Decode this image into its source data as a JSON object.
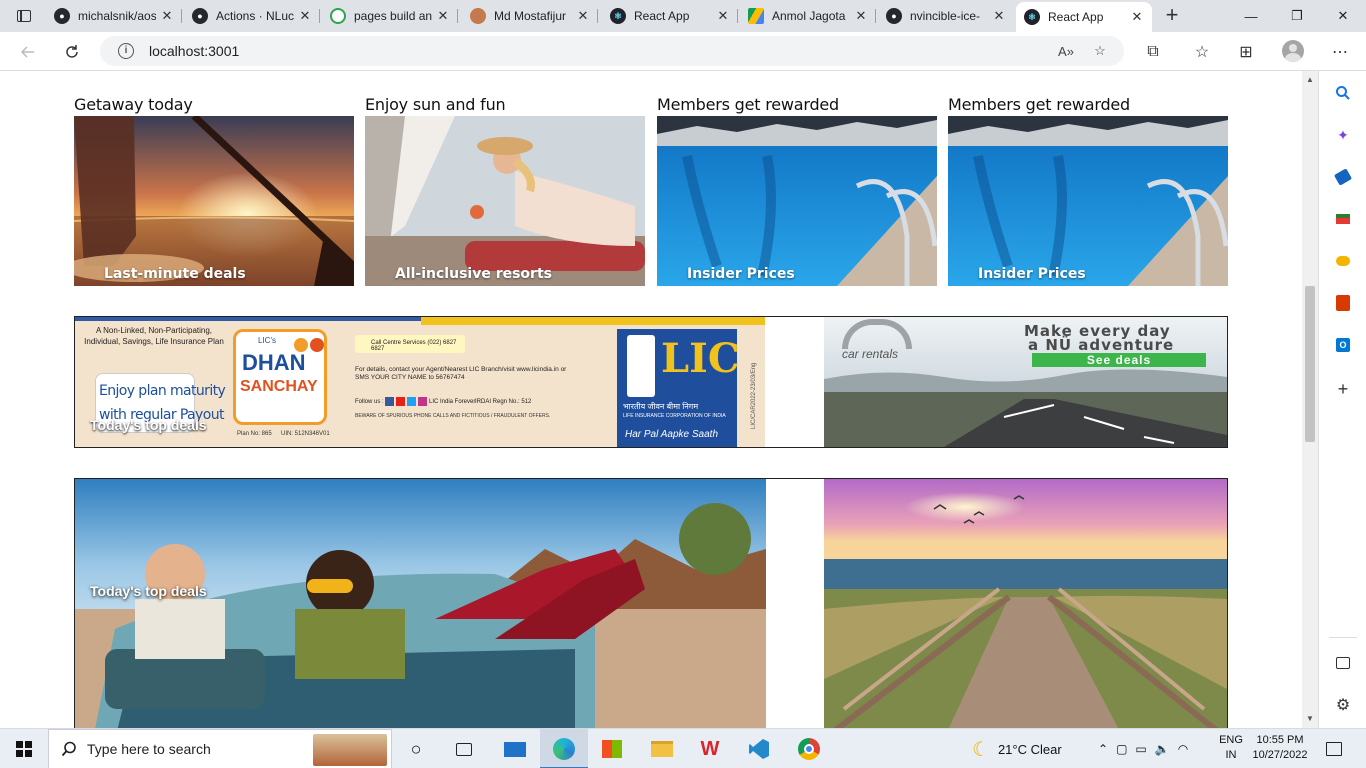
{
  "browser": {
    "tabs": [
      {
        "title": "michalsnik/aos",
        "icon": "github-icon",
        "favicon_color": "#24292f"
      },
      {
        "title": "Actions · NLuc",
        "icon": "github-icon",
        "favicon_color": "#24292f"
      },
      {
        "title": "pages build and",
        "icon": "github-actions-icon",
        "favicon_color": "#2da44e"
      },
      {
        "title": "Md Mostafijur",
        "icon": "avatar-icon",
        "favicon_color": "#c47a4a"
      },
      {
        "title": "React App",
        "icon": "react-icon",
        "favicon_color": "#61dafb"
      },
      {
        "title": "Anmol Jagota",
        "icon": "google-drive-icon",
        "favicon_color": "#fbbc04"
      },
      {
        "title": "nvincible-ice-",
        "icon": "github-icon",
        "favicon_color": "#24292f"
      },
      {
        "title": "React App",
        "icon": "react-icon",
        "favicon_color": "#61dafb",
        "active": true
      }
    ],
    "close_glyph": "✕",
    "new_tab_glyph": "+",
    "window_controls": {
      "minimize": "—",
      "restore": "❐",
      "close": "✕"
    },
    "address": {
      "url": "localhost:3001",
      "info_glyph": "i"
    }
  },
  "page": {
    "cards": [
      {
        "heading": "Getaway today",
        "caption": "Last-minute deals",
        "image": "paddleboard-sunset"
      },
      {
        "heading": "Enjoy sun and fun",
        "caption": "All-inclusive resorts",
        "image": "woman-lounging"
      },
      {
        "heading": "Members get rewarded",
        "caption": "Insider Prices",
        "image": "pool"
      },
      {
        "heading": "Members get rewarded",
        "caption": "Insider Prices",
        "image": "pool"
      }
    ],
    "lic_ad": {
      "top_left": "A Non-Linked, Non-Participating, Individual, Savings, Life Insurance Plan",
      "lic_prefix": "LIC's",
      "product_line1": "DHAN",
      "product_line2": "SANCHAY",
      "plan_no": "Plan No: 865",
      "uin": "UIN: 512N346V01",
      "tagline_line1": "Enjoy plan maturity",
      "tagline_line2": "with regular Payout",
      "call_centre": "Call Centre Services (022) 6827 6827",
      "contact_line1": "For details, contact your Agent/Nearest LIC Branch/visit www.licindia.in or",
      "contact_line2": "SMS YOUR CITY NAME to 56767474",
      "follow_us": "Follow us :",
      "social_handle": "LIC India Forever",
      "irdai": "IRDAI Regn No.: 512",
      "beware": "BEWARE OF SPURIOUS PHONE CALLS AND FICTITIOUS / FRAUDULENT OFFERS.",
      "logo_text": "LIC",
      "hindi_name": "भारतीय जीवन बीमा निगम",
      "english_name": "LIFE INSURANCE CORPORATION OF INDIA",
      "slogan": "Har Pal Aapke Saath",
      "ref_code": "LIC/CAR2022-23/03/Eng"
    },
    "lic_overlay_caption": "Today's top deals",
    "nu_ad": {
      "brand_word": "car rentals",
      "headline_line1": "Make every day",
      "headline_line2": "a NÜ adventure",
      "cta": "See deals"
    },
    "hero_caption": "Today's top deals"
  },
  "edge_sidebar": [
    {
      "icon": "search-icon",
      "color": "#1a73e8"
    },
    {
      "icon": "copilot-sparkle-icon",
      "color": "#7b3fe4"
    },
    {
      "icon": "shopping-tag-icon",
      "color": "#1565c0"
    },
    {
      "icon": "tools-icon",
      "color": "#2e7d32"
    },
    {
      "icon": "games-icon",
      "color": "#f4b400"
    },
    {
      "icon": "office-icon",
      "color": "#d83b01"
    },
    {
      "icon": "outlook-icon",
      "color": "#0078d4"
    },
    {
      "icon": "add-icon",
      "color": "#333333"
    }
  ],
  "taskbar": {
    "search_placeholder": "Type here to search",
    "weather": "21°C  Clear",
    "lang_line1": "ENG",
    "lang_line2": "IN",
    "time": "10:55 PM",
    "date": "10/27/2022"
  }
}
